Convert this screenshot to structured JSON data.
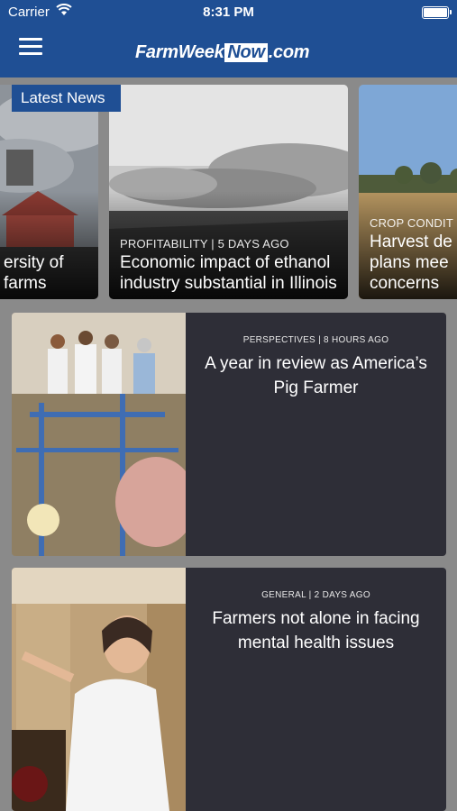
{
  "status_bar": {
    "carrier": "Carrier",
    "time": "8:31 PM"
  },
  "header": {
    "logo_part1": "FarmWeek",
    "logo_part2": "Now",
    "logo_part3": ".com"
  },
  "carousel": {
    "badge": "Latest News",
    "slides": [
      {
        "category": "",
        "title": "ersity of farms"
      },
      {
        "category": "PROFITABILITY | 5 DAYS AGO",
        "title": "Economic impact of ethanol industry substantial in Illinois"
      },
      {
        "category": "CROP CONDIT",
        "title": "Harvest de plans mee concerns"
      }
    ]
  },
  "articles": [
    {
      "meta": "PERSPECTIVES | 8 HOURS AGO",
      "title": "A year in review as America’s Pig Farmer"
    },
    {
      "meta": "GENERAL | 2 DAYS AGO",
      "title": "Farmers not alone in facing mental health issues"
    }
  ],
  "colors": {
    "brand_blue": "#1f4f94",
    "card_bg": "#2e2e37",
    "page_bg": "#8a8a8a"
  },
  "icons": [
    "wifi-icon",
    "battery-icon",
    "menu-icon"
  ]
}
